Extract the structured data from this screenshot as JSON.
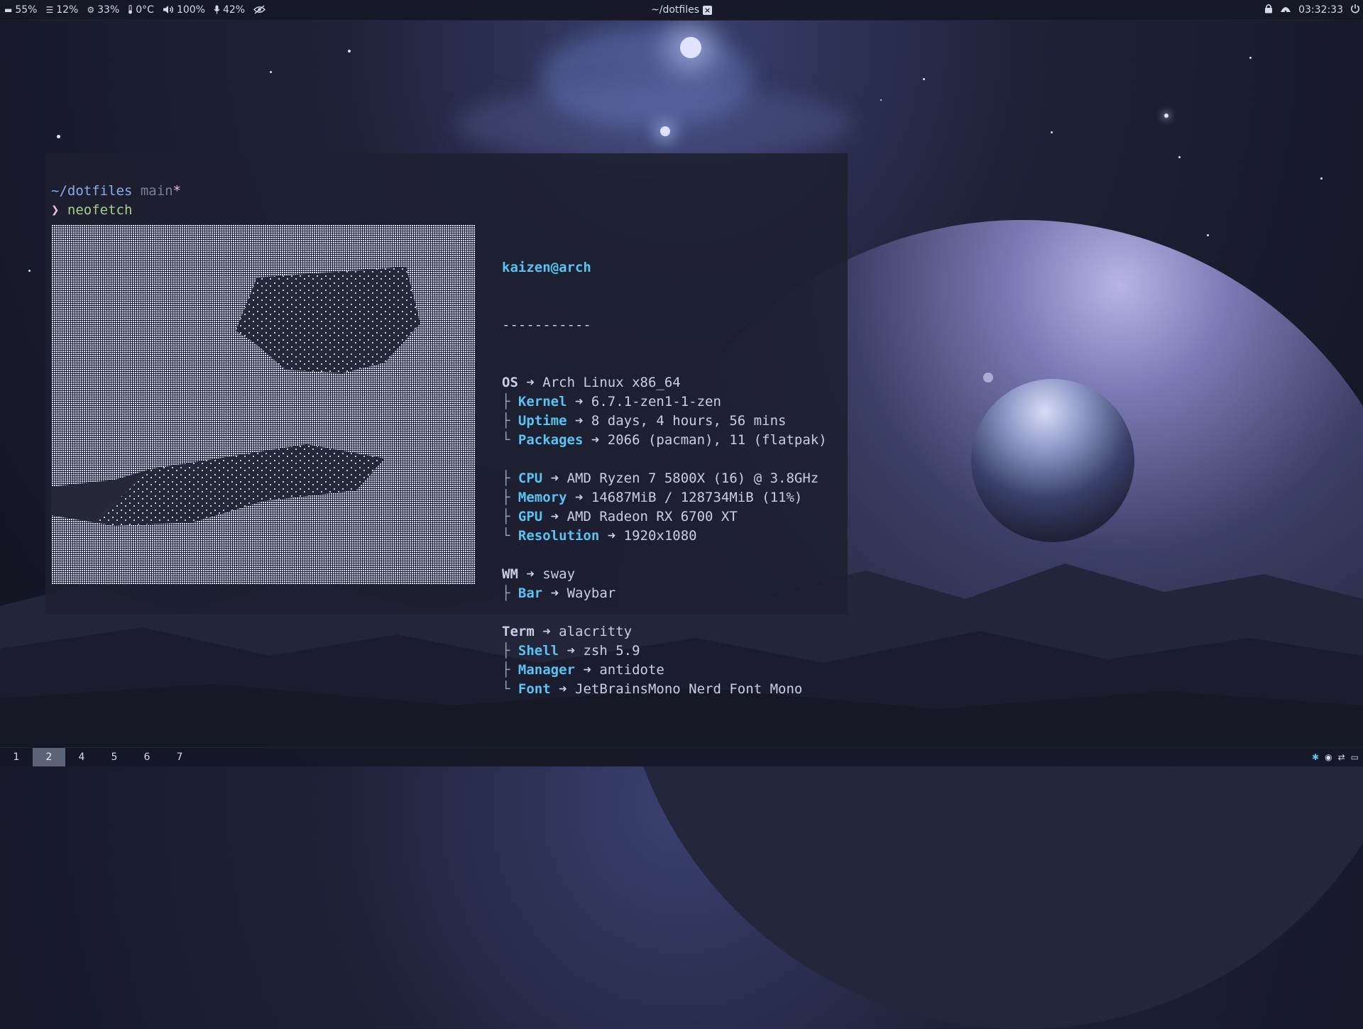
{
  "topbar": {
    "left": [
      {
        "icon": "disk-icon",
        "glyph": "▬",
        "value": "55%"
      },
      {
        "icon": "memory-icon",
        "glyph": "☰",
        "value": "12%"
      },
      {
        "icon": "cpu-icon",
        "glyph": "⚙",
        "value": "33%"
      },
      {
        "icon": "temperature-icon",
        "glyph": "🌡",
        "value": "0°C"
      },
      {
        "icon": "volume-icon",
        "glyph": "🔊",
        "value": "100%"
      },
      {
        "icon": "microphone-icon",
        "glyph": "🎤",
        "value": "42%"
      }
    ],
    "window_title": "~/dotfiles",
    "close_glyph": "×",
    "clock": "03:32:33"
  },
  "terminal": {
    "prompt_path": "~/dotfiles",
    "prompt_branch": "main",
    "prompt_dirty": "*",
    "prompt_symbol": "❯",
    "command": "neofetch",
    "userhost": "kaizen@arch",
    "separator": "-----------",
    "info": [
      {
        "key": "OS",
        "value": "Arch Linux x86_64",
        "level": 0
      },
      {
        "key": "Kernel",
        "value": "6.7.1-zen1-1-zen",
        "level": 1,
        "tree": "├"
      },
      {
        "key": "Uptime",
        "value": "8 days, 4 hours, 56 mins",
        "level": 1,
        "tree": "├"
      },
      {
        "key": "Packages",
        "value": "2066 (pacman), 11 (flatpak)",
        "level": 1,
        "tree": "└"
      },
      {
        "blank": true
      },
      {
        "key": "CPU",
        "value": "AMD Ryzen 7 5800X (16) @ 3.8GHz",
        "level": 1,
        "tree": "├"
      },
      {
        "key": "Memory",
        "value": "14687MiB / 128734MiB (11%)",
        "level": 1,
        "tree": "├"
      },
      {
        "key": "GPU",
        "value": "AMD Radeon RX 6700 XT",
        "level": 1,
        "tree": "├"
      },
      {
        "key": "Resolution",
        "value": "1920x1080",
        "level": 1,
        "tree": "└"
      },
      {
        "blank": true
      },
      {
        "key": "WM",
        "value": "sway",
        "level": 0
      },
      {
        "key": "Bar",
        "value": "Waybar",
        "level": 1,
        "tree": "├"
      },
      {
        "blank": true
      },
      {
        "key": "Term",
        "value": "alacritty",
        "level": 0
      },
      {
        "key": "Shell",
        "value": "zsh 5.9",
        "level": 1,
        "tree": "├"
      },
      {
        "key": "Manager",
        "value": "antidote",
        "level": 1,
        "tree": "├"
      },
      {
        "key": "Font",
        "value": "JetBrainsMono Nerd Font Mono",
        "level": 1,
        "tree": "└"
      }
    ],
    "arrow": "➜"
  },
  "workspaces": [
    {
      "label": "1",
      "active": false
    },
    {
      "label": "2",
      "active": true
    },
    {
      "label": "4",
      "active": false
    },
    {
      "label": "5",
      "active": false
    },
    {
      "label": "6",
      "active": false
    },
    {
      "label": "7",
      "active": false
    }
  ],
  "colors": {
    "accent_cyan": "#59c3f3",
    "path_blue": "#8caaee",
    "pink": "#f4b8e4",
    "green": "#a6d189",
    "active_workspace": "#5b6378"
  }
}
